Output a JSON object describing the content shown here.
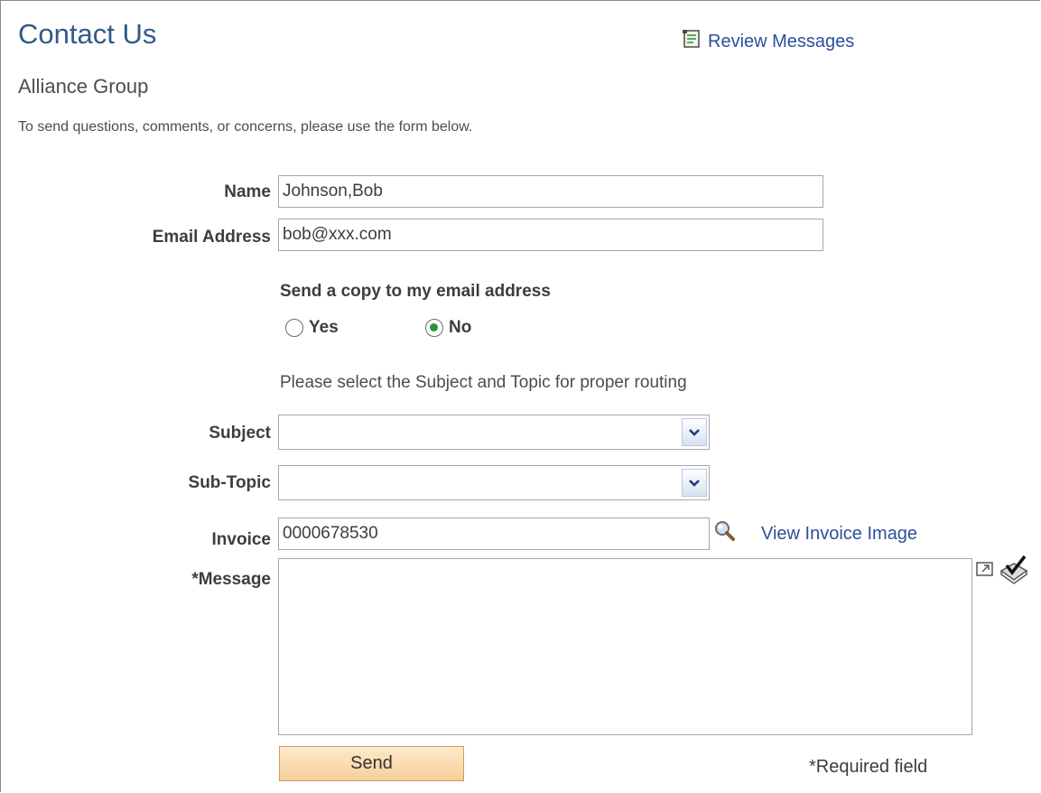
{
  "page": {
    "title": "Contact Us",
    "review_messages": "Review Messages",
    "group": "Alliance Group",
    "instructions": "To send questions, comments, or concerns, please use the form below."
  },
  "form": {
    "name_label": "Name",
    "name_value": "Johnson,Bob",
    "email_label": "Email Address",
    "email_value": "bob@xxx.com",
    "copy_label": "Send a copy to my email address",
    "copy_options": [
      {
        "label": "Yes",
        "checked": false
      },
      {
        "label": "No",
        "checked": true
      }
    ],
    "routing_text": "Please select the Subject and Topic for proper routing",
    "subject_label": "Subject",
    "subject_value": "",
    "subtopic_label": "Sub-Topic",
    "subtopic_value": "",
    "invoice_label": "Invoice",
    "invoice_value": "0000678530",
    "view_invoice": "View Invoice Image",
    "message_label": "*Message",
    "message_value": "",
    "send_label": "Send",
    "required_note": "*Required field"
  },
  "icons": {
    "review": "notepad-icon",
    "dropdown": "chevron-down-icon",
    "lookup": "magnifier-icon",
    "expand": "popup-expand-icon",
    "spellcheck": "spellcheck-icon"
  },
  "colors": {
    "title": "#31598a",
    "link": "#2d4f9b",
    "button": "#f6cf9a",
    "radio_checked": "#2f8f3a"
  }
}
